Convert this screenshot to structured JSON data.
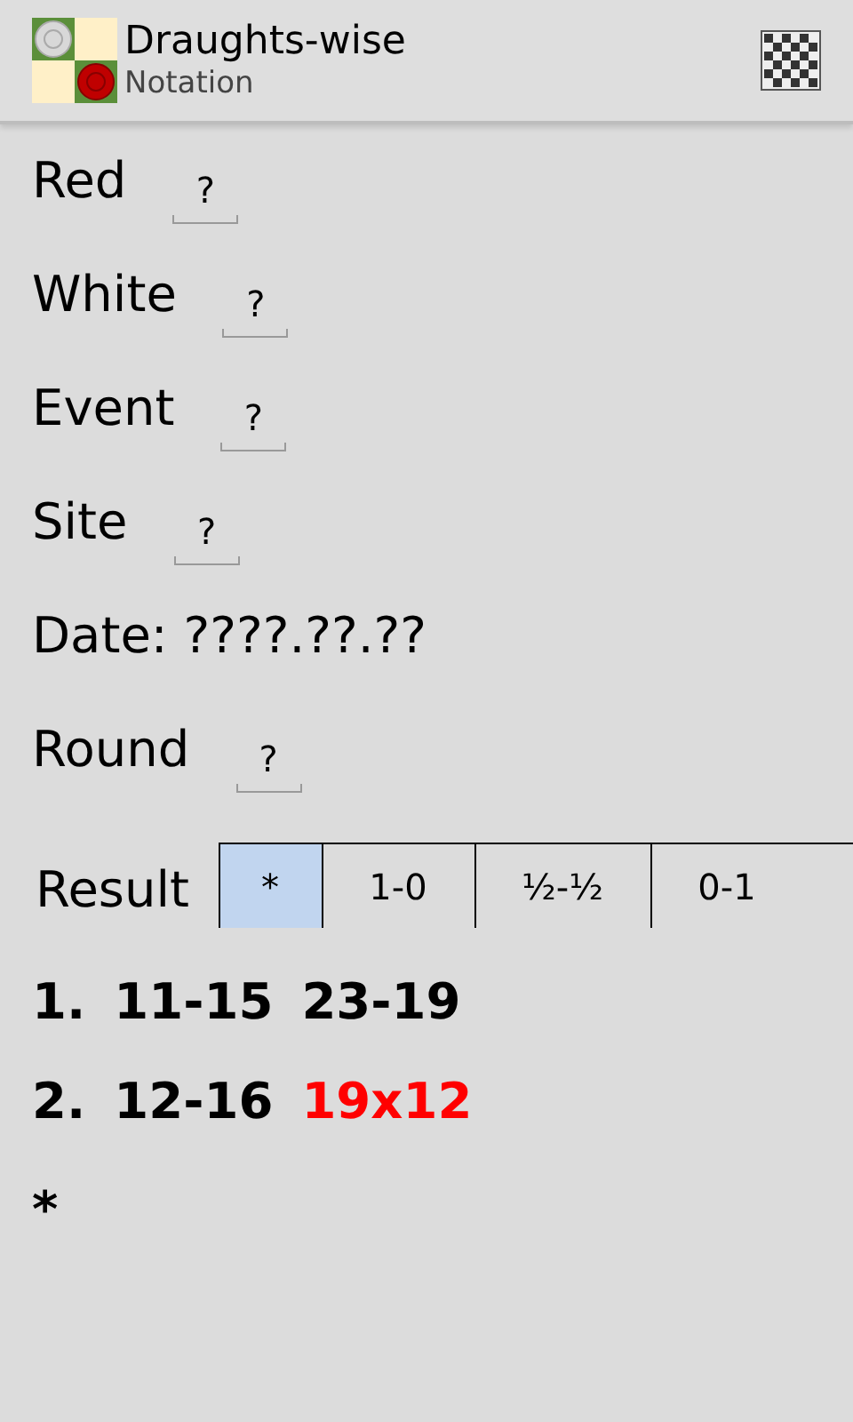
{
  "app_bar": {
    "title": "Draughts-wise",
    "subtitle": "Notation"
  },
  "fields": [
    {
      "kind": "input",
      "label": "Red",
      "value": "?"
    },
    {
      "kind": "input",
      "label": "White",
      "value": "?"
    },
    {
      "kind": "input",
      "label": "Event",
      "value": "?"
    },
    {
      "kind": "input",
      "label": "Site",
      "value": "?"
    },
    {
      "kind": "text",
      "text": "Date: ????.??.??"
    },
    {
      "kind": "input",
      "label": "Round",
      "value": "?"
    }
  ],
  "result": {
    "label": "Result",
    "options": [
      {
        "label": "*",
        "selected": true
      },
      {
        "label": "1-0",
        "selected": false
      },
      {
        "label": "½-½",
        "selected": false
      },
      {
        "label": "0-1",
        "selected": false
      }
    ]
  },
  "moves": [
    {
      "number": "1.",
      "plies": [
        {
          "text": "11-15",
          "highlighted": false
        },
        {
          "text": "23-19",
          "highlighted": false
        }
      ]
    },
    {
      "number": "2.",
      "plies": [
        {
          "text": "12-16",
          "highlighted": false
        },
        {
          "text": "19x12",
          "highlighted": true
        }
      ]
    }
  ],
  "game_end": "*"
}
